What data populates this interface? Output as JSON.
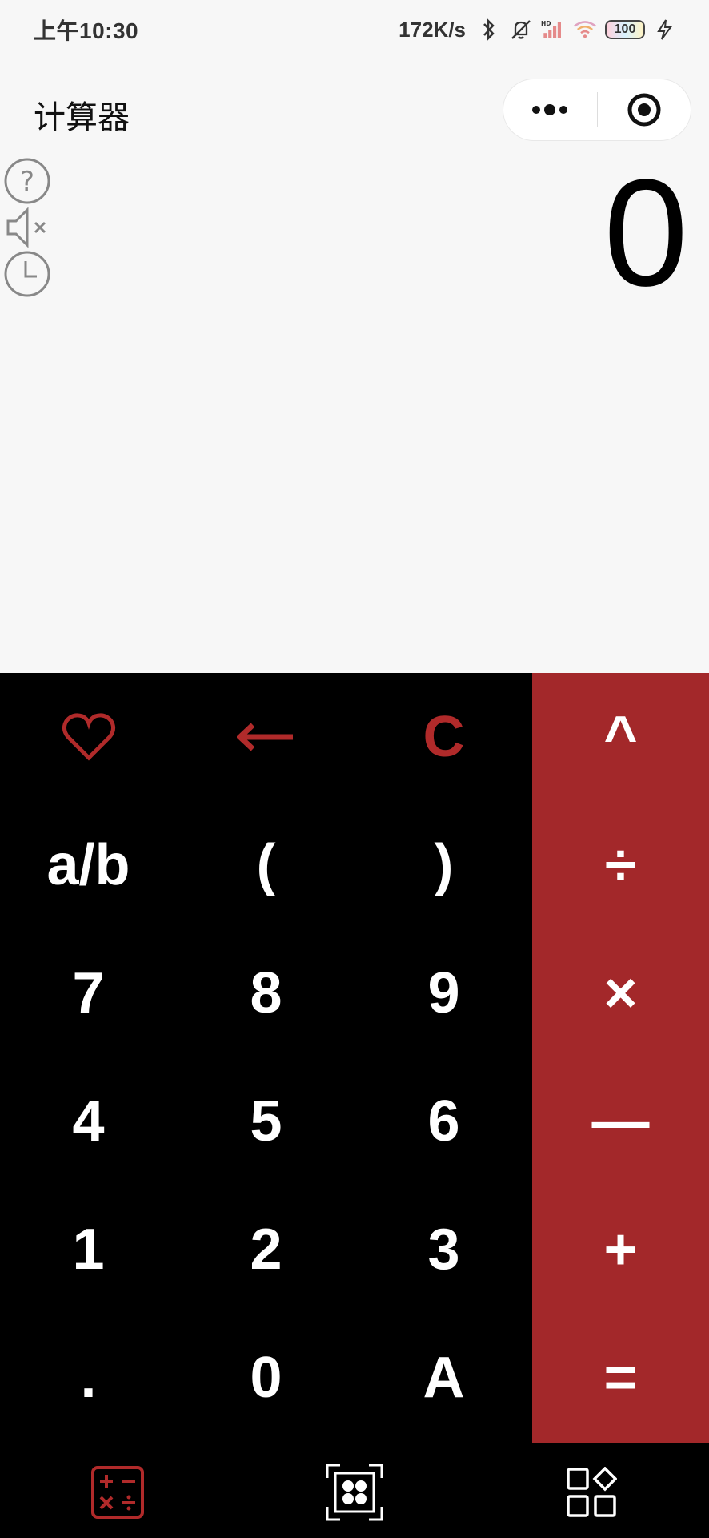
{
  "status_bar": {
    "time": "上午10:30",
    "net_speed": "172K/s",
    "battery": "100",
    "icons": [
      "bluetooth-icon",
      "mute-bell-icon",
      "signal-hd-icon",
      "wifi-icon",
      "battery-icon",
      "charging-icon"
    ]
  },
  "title_bar": {
    "title": "计算器",
    "capsule_icons": [
      "more-dots-icon",
      "close-target-icon"
    ]
  },
  "side_tools": [
    "help-icon",
    "mute-speaker-icon",
    "history-clock-icon"
  ],
  "display": {
    "value": "0"
  },
  "keypad": {
    "rows": [
      [
        "♡",
        "←",
        "C",
        "^"
      ],
      [
        "a/b",
        "(",
        ")",
        "÷"
      ],
      [
        "7",
        "8",
        "9",
        "×"
      ],
      [
        "4",
        "5",
        "6",
        "—"
      ],
      [
        "1",
        "2",
        "3",
        "+"
      ],
      [
        ".",
        "0",
        "A",
        "="
      ]
    ]
  },
  "tab_bar": {
    "icons": [
      "calculator-tab-icon",
      "scan-tab-icon",
      "apps-tab-icon"
    ]
  },
  "colors": {
    "accent": "#a3282a",
    "accent_text": "#b02a2a",
    "keypad_bg": "#000000",
    "page_bg": "#f7f7f7"
  }
}
